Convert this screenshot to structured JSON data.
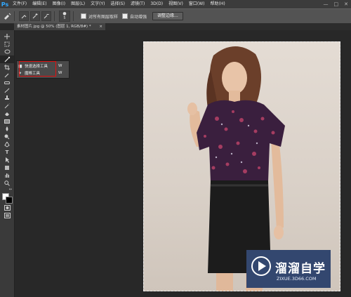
{
  "app": {
    "logo": "Ps"
  },
  "menu": [
    "文件(F)",
    "编辑(E)",
    "图像(I)",
    "图层(L)",
    "文字(Y)",
    "选择(S)",
    "滤镜(T)",
    "3D(D)",
    "视图(V)",
    "窗口(W)",
    "帮助(H)"
  ],
  "window_controls": {
    "minimize": "—",
    "maximize": "□",
    "close": "✕"
  },
  "options": {
    "size_value": "5",
    "sample_all_layers": "对所有图层取样",
    "auto_enhance": "自动增强",
    "refine_edge": "调整边缘..."
  },
  "document_tab": {
    "label": "素材图片.jpg @ 50% (图层 1, RGB/8#) *"
  },
  "flyout": {
    "items": [
      {
        "label": "快速选择工具",
        "shortcut": "W",
        "icon": "quick-selection-icon"
      },
      {
        "label": "魔棒工具",
        "shortcut": "W",
        "icon": "magic-wand-icon"
      }
    ]
  },
  "watermark": {
    "title": "溜溜自学",
    "url": "ZIXUE.3D66.COM"
  },
  "colors": {
    "highlight": "#e01010",
    "watermark_bg": "#33476f",
    "ps_blue": "#31a8ff"
  }
}
